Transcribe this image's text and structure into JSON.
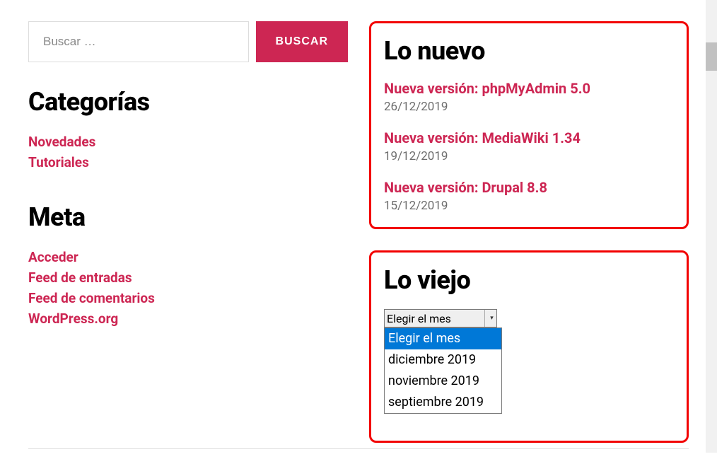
{
  "search": {
    "placeholder": "Buscar …",
    "button": "BUSCAR"
  },
  "categories": {
    "title": "Categorías",
    "items": [
      {
        "label": "Novedades"
      },
      {
        "label": "Tutoriales"
      }
    ]
  },
  "meta": {
    "title": "Meta",
    "items": [
      {
        "label": "Acceder"
      },
      {
        "label": "Feed de entradas"
      },
      {
        "label": "Feed de comentarios"
      },
      {
        "label": "WordPress.org"
      }
    ]
  },
  "lo_nuevo": {
    "title": "Lo nuevo",
    "posts": [
      {
        "title": "Nueva versión: phpMyAdmin 5.0",
        "date": "26/12/2019"
      },
      {
        "title": "Nueva versión: MediaWiki 1.34",
        "date": "19/12/2019"
      },
      {
        "title": "Nueva versión: Drupal 8.8",
        "date": "15/12/2019"
      }
    ]
  },
  "lo_viejo": {
    "title": "Lo viejo",
    "selected": "Elegir el mes",
    "options": [
      "Elegir el mes",
      "diciembre 2019",
      "noviembre 2019",
      "septiembre 2019"
    ]
  }
}
